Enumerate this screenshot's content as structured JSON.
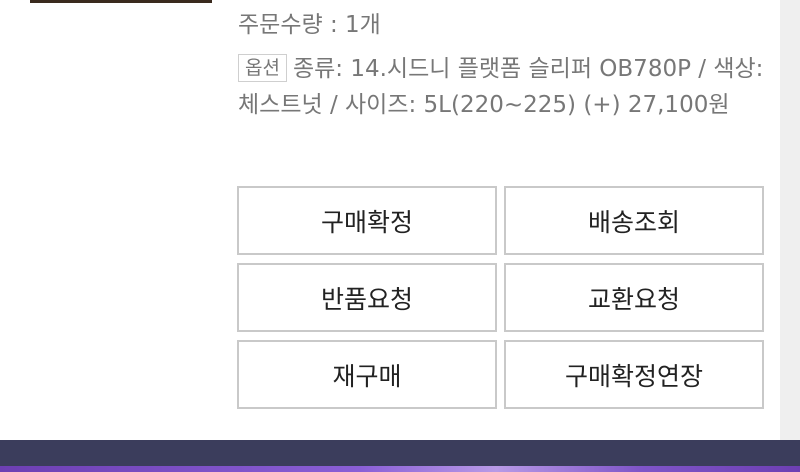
{
  "order": {
    "quantity_text": "주문수량 : 1개",
    "option_badge": "옵션",
    "option_text": "종류: 14.시드니 플랫폼 슬리퍼 OB780P / 색상: 체스트넛 / 사이즈: 5L(220~225) (+) 27,100원"
  },
  "buttons": {
    "confirm_purchase": "구매확정",
    "track_delivery": "배송조회",
    "request_return": "반품요청",
    "request_exchange": "교환요청",
    "repurchase": "재구매",
    "extend_confirmation": "구매확정연장"
  },
  "colors": {
    "text_muted": "#777777",
    "button_border": "#c9c9c9",
    "bottom_bar": "#3b3d5c",
    "accent_purple": "#6d3fb3"
  }
}
